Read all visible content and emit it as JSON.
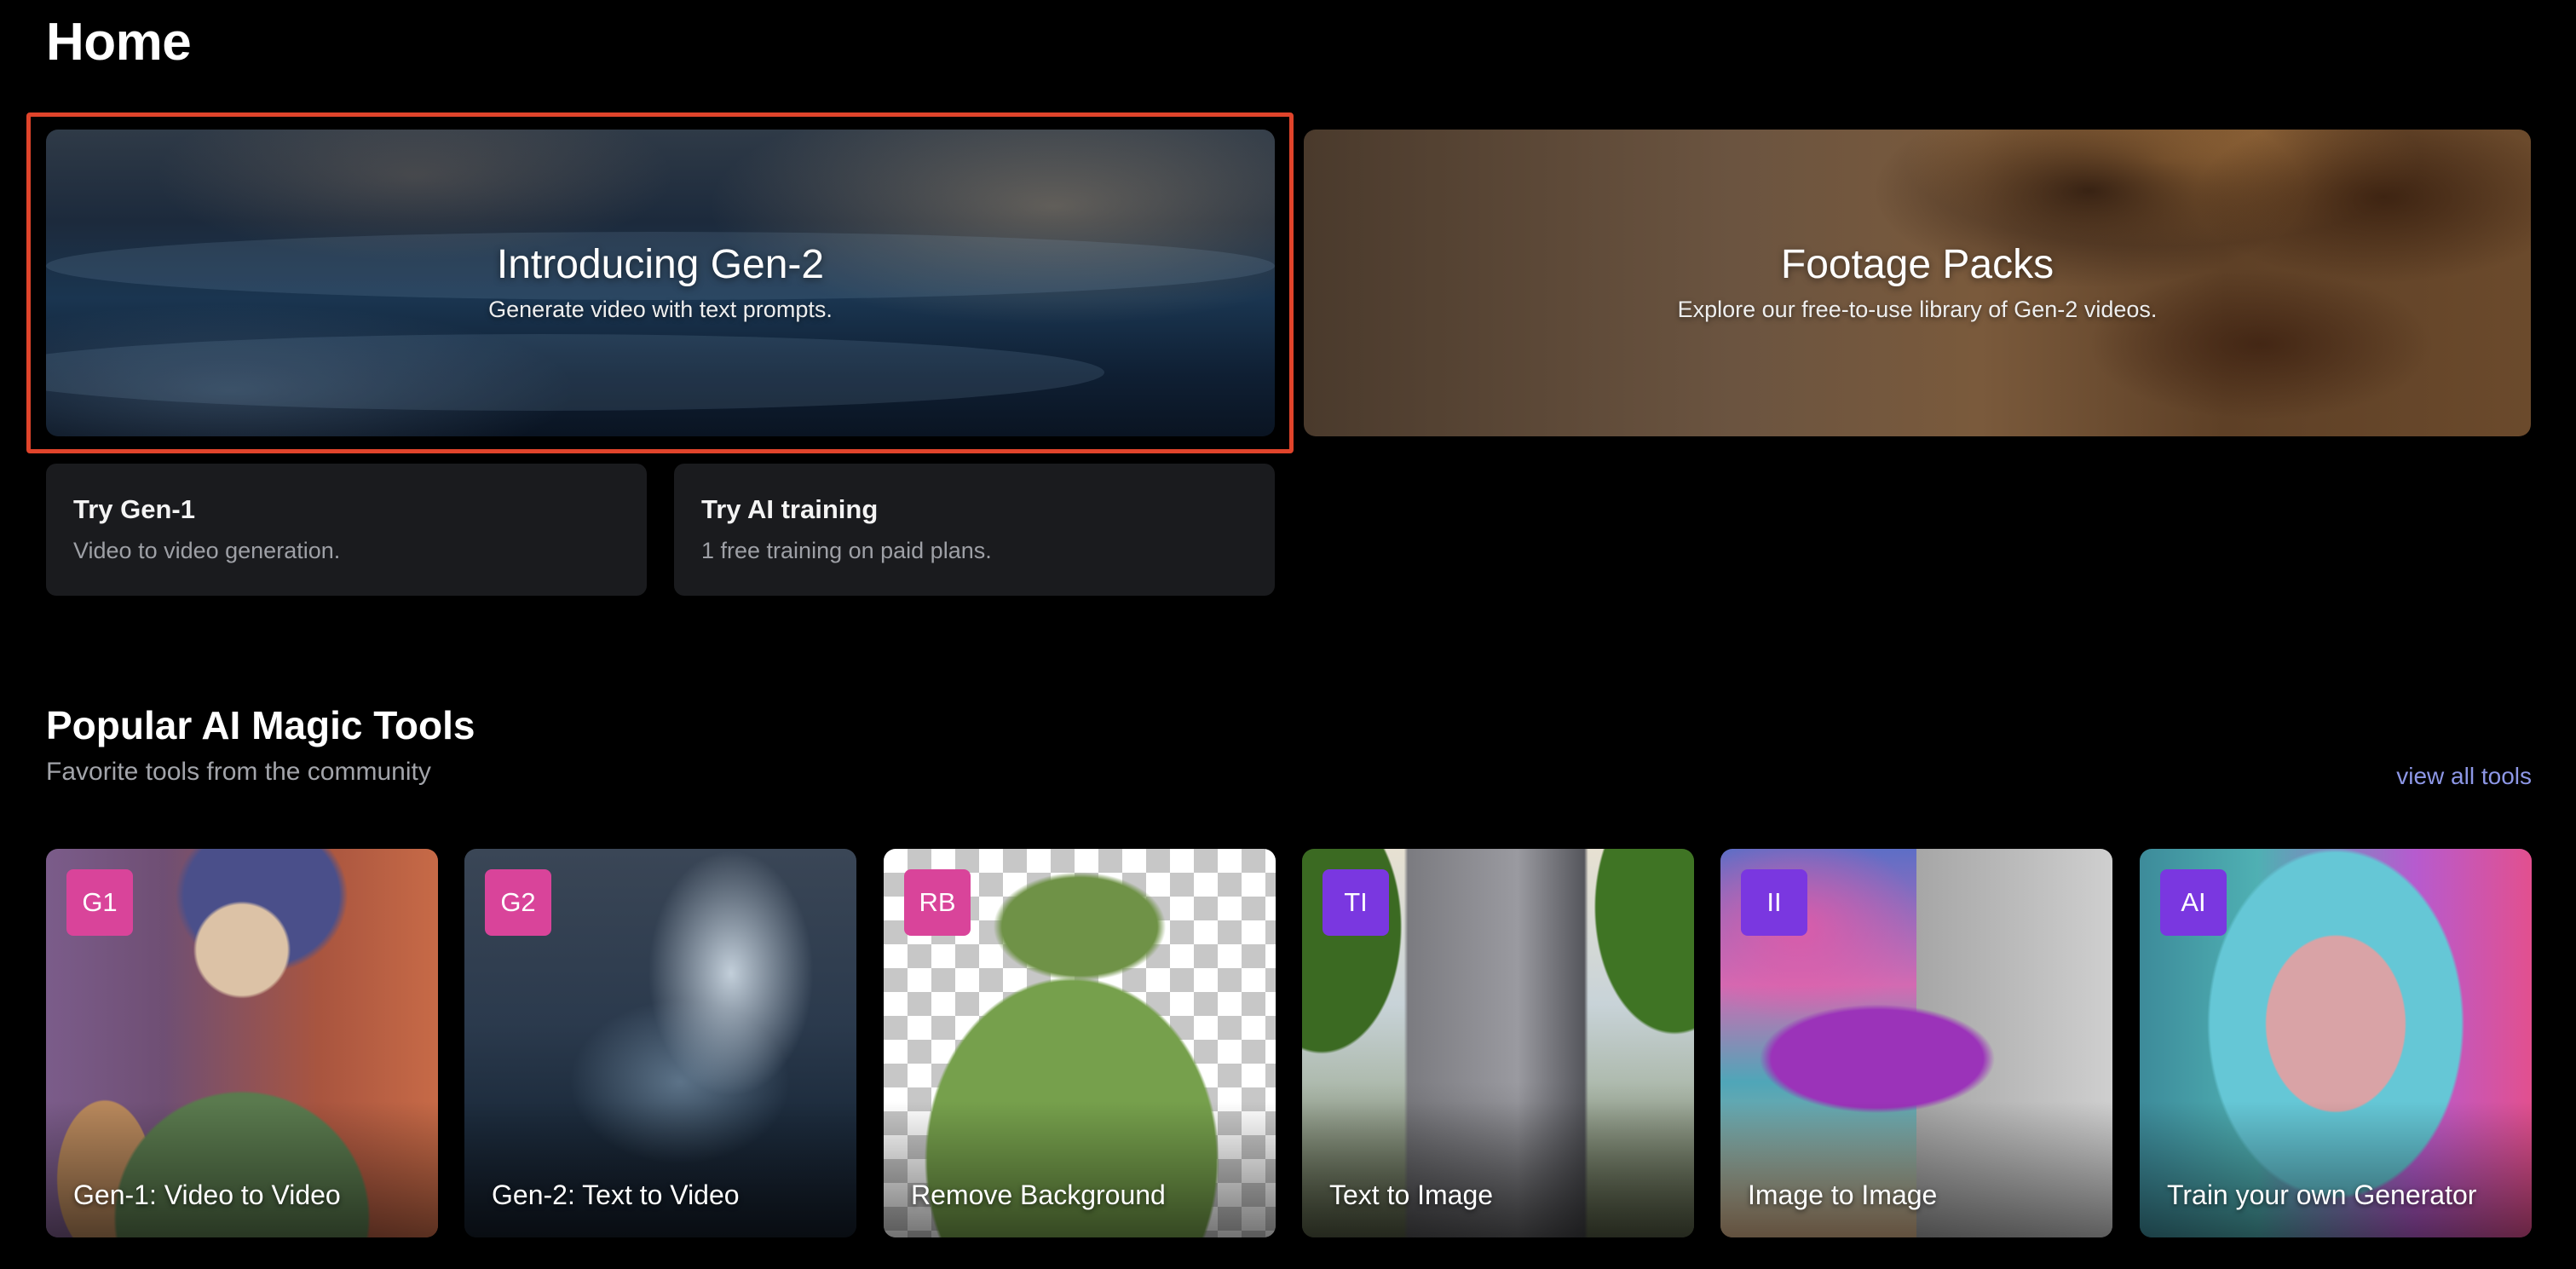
{
  "page": {
    "title": "Home"
  },
  "hero": [
    {
      "title": "Introducing Gen-2",
      "subtitle": "Generate video with text prompts."
    },
    {
      "title": "Footage Packs",
      "subtitle": "Explore our free-to-use library of Gen-2 videos."
    }
  ],
  "cards": [
    {
      "title": "Try Gen-1",
      "description": "Video to video generation."
    },
    {
      "title": "Try AI training",
      "description": "1 free training on paid plans."
    }
  ],
  "section": {
    "title": "Popular AI Magic Tools",
    "subtitle": "Favorite tools from the community",
    "view_all": "view all tools"
  },
  "tools": [
    {
      "badge": "G1",
      "label": "Gen-1: Video to Video",
      "badge_color": "#d9449a"
    },
    {
      "badge": "G2",
      "label": "Gen-2: Text to Video",
      "badge_color": "#d9449a"
    },
    {
      "badge": "RB",
      "label": "Remove Background",
      "badge_color": "#d9449a"
    },
    {
      "badge": "TI",
      "label": "Text to Image",
      "badge_color": "#7a37e0"
    },
    {
      "badge": "II",
      "label": "Image to Image",
      "badge_color": "#7a37e0"
    },
    {
      "badge": "AI",
      "label": "Train your own Generator",
      "badge_color": "#7a37e0"
    }
  ],
  "colors": {
    "highlight": "#e0442b",
    "card_bg": "#1a1b1e",
    "link": "#8d97e6"
  }
}
